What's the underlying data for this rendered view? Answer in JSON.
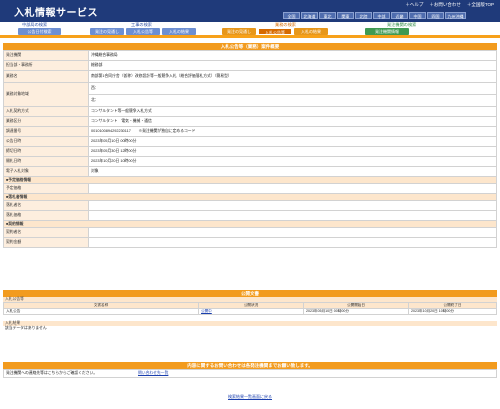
{
  "header": {
    "title": "入札情報サービス",
    "links": [
      "＋ヘルプ",
      "＋お問い合わせ",
      "＋全国版TOP"
    ],
    "regions": [
      "全国",
      "北海道",
      "東北",
      "関東",
      "北陸",
      "中部",
      "近畿",
      "中国",
      "四国",
      "九州沖縄"
    ]
  },
  "menu": {
    "labels": [
      "中部局の検索",
      "工事の検索",
      "業務の検索",
      "発注機関の検索"
    ],
    "buttons": [
      "公告日付検索",
      "発注の見通し",
      "入札公告等",
      "入札の結果",
      "発注の見通し",
      "入札公告等",
      "入札の結果",
      "発注機関情報"
    ]
  },
  "detail": {
    "heading": "入札公告等（業務）案件概要",
    "rows": [
      {
        "label": "発注機関",
        "value": "沖縄総合事務局"
      },
      {
        "label": "担当部・事務所",
        "value": "総務部"
      },
      {
        "label": "業務名",
        "value": "南部第1合同庁舎（仮称）改修設計等一般競争入札（総合評価落札方式）（簡易型）"
      },
      {
        "label": "業務対象地域",
        "value": "西："
      },
      {
        "label": "",
        "value": "北："
      },
      {
        "label": "入札契約方式",
        "value": "コンサルタント等一般競争入札方式"
      },
      {
        "label": "業務区分",
        "value": "コンサルタント　電気・機械・通信"
      },
      {
        "label": "調達番号",
        "value": "0010100894292230117　　※発注機関が独自に定めるコード"
      },
      {
        "label": "公告日時",
        "value": "2023年05月10日 00時00分"
      },
      {
        "label": "締切日時",
        "value": "2023年05月30日 12時00分"
      },
      {
        "label": "開札日時",
        "value": "2023年10月20日 10時00分"
      },
      {
        "label": "電子入札対象",
        "value": "対象"
      }
    ],
    "sections": [
      "■予定価格情報",
      "■落札者情報",
      "■契約情報"
    ],
    "price_rows": [
      "予定価格"
    ],
    "winner_rows": [
      "落札者名",
      "落札価格"
    ],
    "contract_rows": [
      "契約者名",
      "契約金額"
    ]
  },
  "announcement": {
    "heading": "公開文書",
    "sub1": "入札公告等",
    "columns": [
      "文書名称",
      "公開状況",
      "公開開始日",
      "公開終了日"
    ],
    "row": [
      "入札公告",
      "公開中",
      "2023年05月10日 00時00分",
      "2023年10月20日 10時00分"
    ],
    "sub2": "入札結果",
    "no_data": "該当データはありません"
  },
  "contact": {
    "heading": "内容に関するお問い合わせは各発注機関までお願い致します。",
    "left": "発注機関への連絡先等はこちらからご確認ください。",
    "link": "問い合わせ先一覧"
  },
  "back": "検索結果一覧画面に戻る"
}
